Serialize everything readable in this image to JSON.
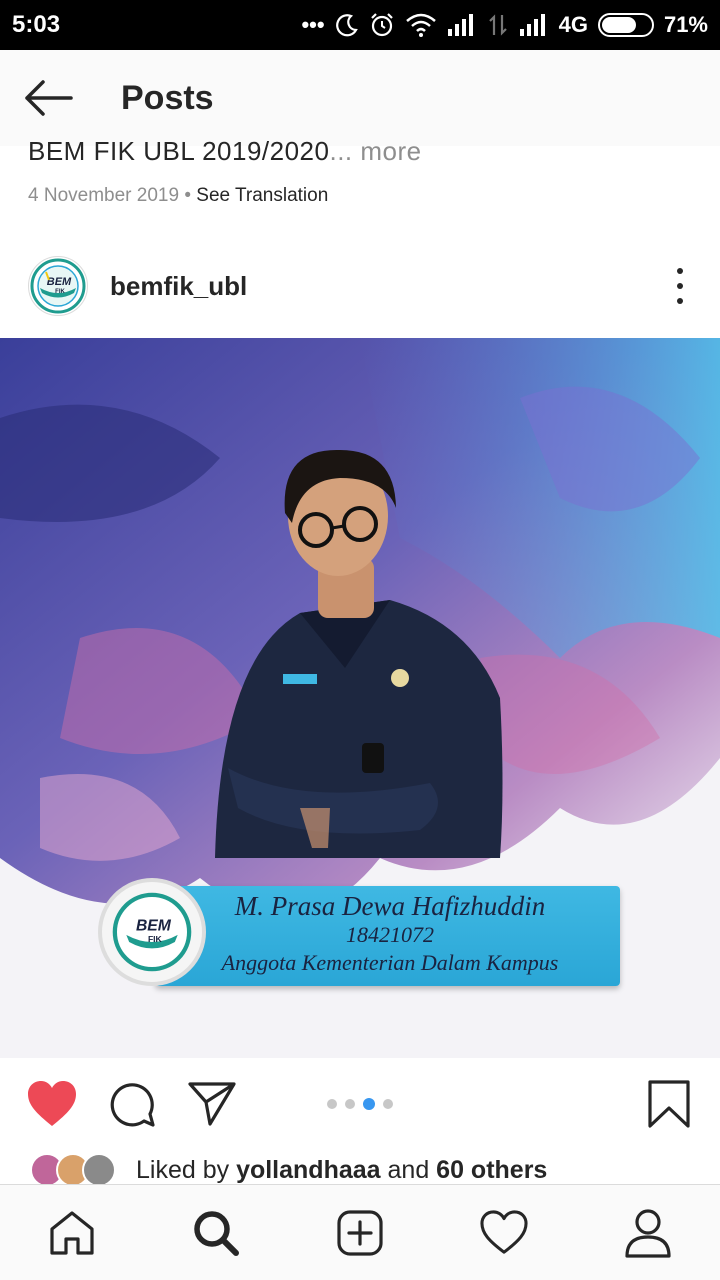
{
  "status_bar": {
    "time": "5:03",
    "network": "4G",
    "battery": "71%",
    "battery_level": 0.71
  },
  "header": {
    "title": "Posts",
    "back_icon": "arrow-left-icon"
  },
  "previous_post": {
    "caption": "BEM FIK UBL 2019/2020",
    "more": "... more",
    "date": "4 November 2019",
    "separator": " • ",
    "see_translation": "See Translation"
  },
  "post": {
    "username": "bemfik_ubl",
    "logo_text": "BEM",
    "logo_sub": "FIK",
    "image": {
      "name": "M. Prasa Dewa Hafizhuddin",
      "nim": "18421072",
      "role": "Anggota Kementerian Dalam Kampus"
    },
    "carousel": {
      "count": 4,
      "active_index": 2
    },
    "liked": true,
    "likes": {
      "prefix": "Liked by ",
      "user": "yollandhaaa",
      "middle": " and ",
      "others": "60 others"
    }
  },
  "colors": {
    "like_red": "#ed4956",
    "active_dot": "#3897f0",
    "banner_blue": "#2aa6d6"
  },
  "bottom_nav": {
    "items": [
      "home-icon",
      "search-icon",
      "add-post-icon",
      "activity-heart-icon",
      "profile-icon"
    ],
    "active": "search-icon"
  }
}
